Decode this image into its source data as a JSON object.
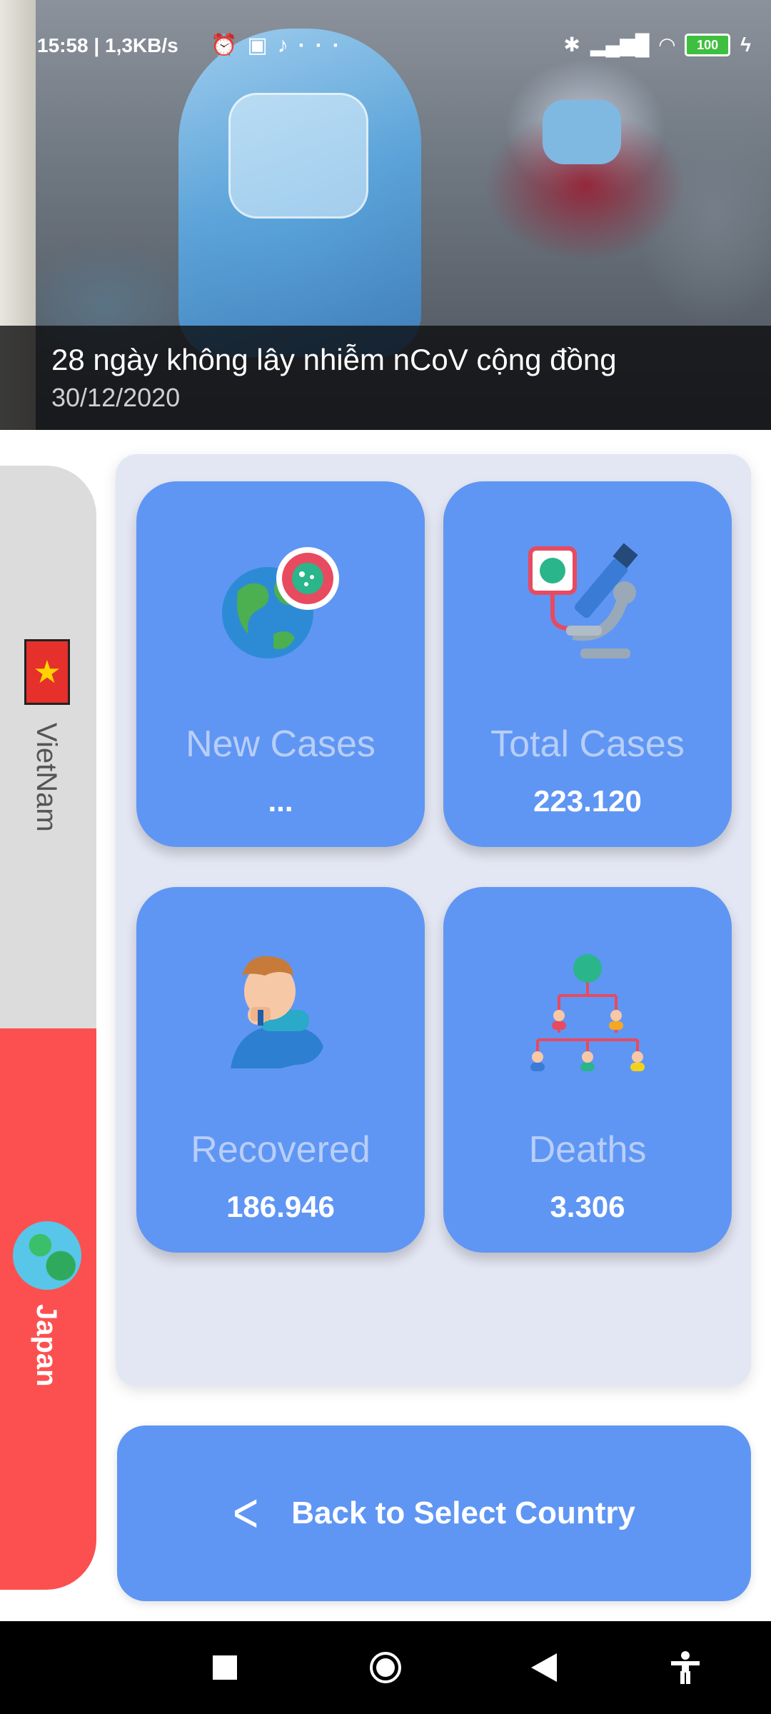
{
  "status_bar": {
    "time_speed": "15:58 | 1,3KB/s",
    "icons": [
      "alarm-icon",
      "messenger-icon",
      "tiktok-icon",
      "more-icon"
    ],
    "right_icons": [
      "bluetooth-icon",
      "signal-icon",
      "wifi-icon",
      "battery-icon",
      "charging-icon"
    ],
    "battery": "100"
  },
  "headline": {
    "title": "28 ngày không lây nhiễm nCoV cộng đồng",
    "date": "30/12/2020"
  },
  "countries": [
    {
      "name": "VietNam",
      "flag": "vietnam-flag-icon",
      "selected": false,
      "tab_color": "#dcdcdc"
    },
    {
      "name": "Japan",
      "flag": "globe-icon",
      "selected": true,
      "tab_color": "#fc5050"
    }
  ],
  "stats": [
    {
      "label": "New Cases",
      "value": "...",
      "icon": "globe-virus-icon"
    },
    {
      "label": "Total Cases",
      "value": "223.120",
      "icon": "microscope-icon"
    },
    {
      "label": "Recovered",
      "value": "186.946",
      "icon": "coughing-person-icon"
    },
    {
      "label": "Deaths",
      "value": "3.306",
      "icon": "spread-tree-icon"
    }
  ],
  "back_button": {
    "label": "Back to Select Country",
    "icon": "chevron-left-icon"
  },
  "nav": {
    "items": [
      "recents-button",
      "home-button",
      "back-button",
      "accessibility-button"
    ]
  },
  "colors": {
    "card": "#5f96f4",
    "panel": "#e3e6f3",
    "active_tab": "#fc5050",
    "inactive_tab": "#dcdcdc"
  }
}
